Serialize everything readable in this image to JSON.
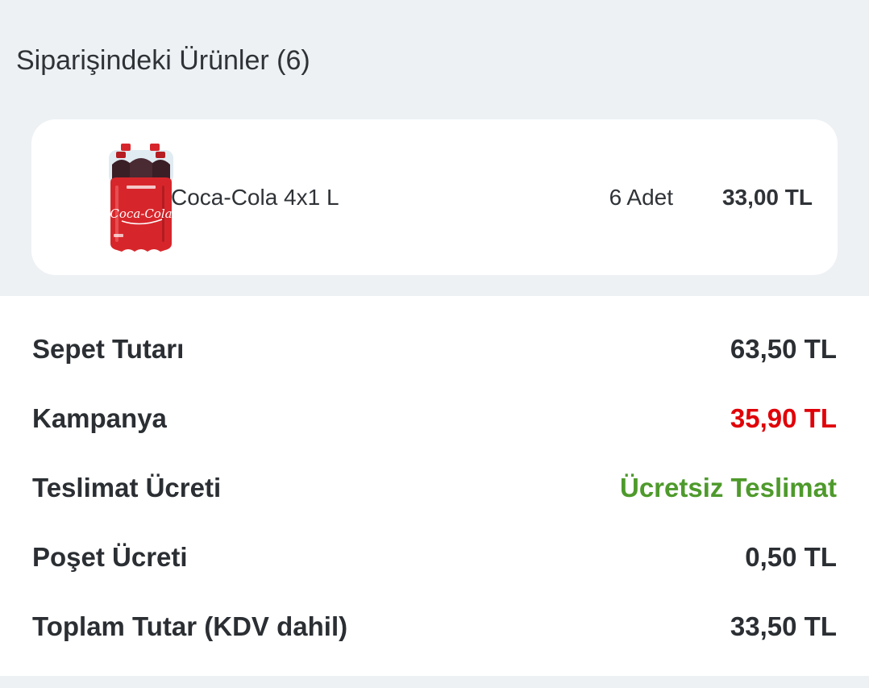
{
  "section": {
    "title": "Siparişindeki Ürünler (6)"
  },
  "items": [
    {
      "name": "Coca-Cola 4x1 L",
      "quantity": "6 Adet",
      "price": "33,00 TL",
      "icon": "coca-cola-bottle-pack-image"
    }
  ],
  "summary": {
    "basket_label": "Sepet Tutarı",
    "basket_value": "63,50 TL",
    "campaign_label": "Kampanya",
    "campaign_value": "35,90 TL",
    "delivery_label": "Teslimat Ücreti",
    "delivery_value": "Ücretsiz Teslimat",
    "bag_label": "Poşet Ücreti",
    "bag_value": "0,50 TL",
    "total_label": "Toplam Tutar (KDV dahil)",
    "total_value": "33,50 TL"
  },
  "colors": {
    "page_background": "#edf1f4",
    "card_background": "#ffffff",
    "text": "#2b2f33",
    "discount": "#e00008",
    "free_delivery": "#4e9a2c",
    "coke_red": "#d7262b"
  }
}
